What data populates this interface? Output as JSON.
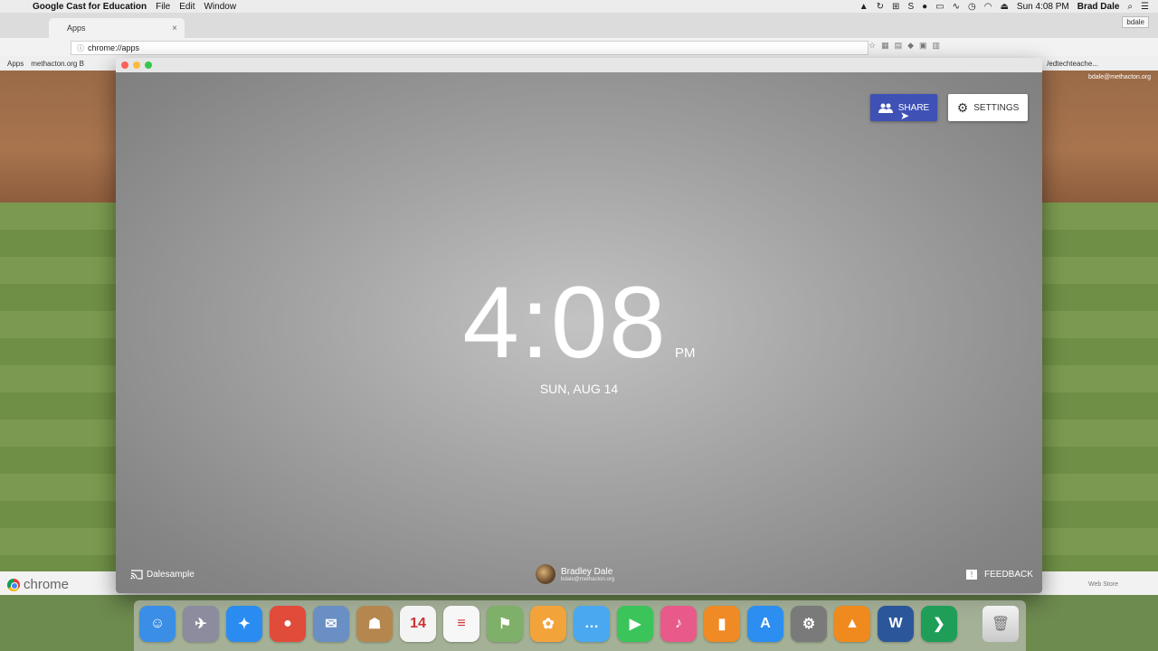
{
  "menubar": {
    "app_name": "Google Cast for Education",
    "items": [
      "File",
      "Edit",
      "Window"
    ],
    "clock": "Sun 4:08 PM",
    "user": "Brad Dale",
    "status_icons": [
      "drive-icon",
      "sync-icon",
      "grid-icon",
      "s-icon",
      "mic-icon",
      "airplay-icon",
      "wave-icon",
      "time-machine-icon",
      "wifi-icon",
      "eject-icon"
    ]
  },
  "browser": {
    "tab_title": "Apps",
    "address": "chrome://apps",
    "user_chip": "bdale",
    "bookmarks": [
      "Apps",
      "methacton.org B"
    ],
    "bookmark_right": "/edtechteache...",
    "email_corner": "bdale@methacton.org",
    "footer_logo": "chrome",
    "web_store": "Web Store"
  },
  "cast": {
    "share_label": "SHARE",
    "settings_label": "SETTINGS",
    "time": "4:08",
    "ampm": "PM",
    "date": "SUN, AUG 14",
    "device_name": "Dalesample",
    "user_name": "Bradley Dale",
    "user_email": "bdale@methacton.org",
    "feedback_label": "FEEDBACK",
    "accent_color": "#3f51b5"
  },
  "dock": {
    "apps": [
      {
        "name": "finder-icon",
        "glyph": "☺",
        "color": "#3a8ee6"
      },
      {
        "name": "launchpad-icon",
        "glyph": "✈",
        "color": "#8c8c9e"
      },
      {
        "name": "safari-icon",
        "glyph": "✦",
        "color": "#2a8cf0"
      },
      {
        "name": "chrome-icon",
        "glyph": "●",
        "color": "#e04b3a"
      },
      {
        "name": "preview-icon",
        "glyph": "✉",
        "color": "#6a8fc4"
      },
      {
        "name": "contacts-icon",
        "glyph": "☗",
        "color": "#b5874f"
      },
      {
        "name": "calendar-icon",
        "glyph": "14",
        "color": "#f4f4f4"
      },
      {
        "name": "reminders-icon",
        "glyph": "≡",
        "color": "#f7f7f7"
      },
      {
        "name": "maps-icon",
        "glyph": "⚑",
        "color": "#7fb069"
      },
      {
        "name": "photos-icon",
        "glyph": "✿",
        "color": "#f2a33a"
      },
      {
        "name": "messages-icon",
        "glyph": "…",
        "color": "#4aa8f0"
      },
      {
        "name": "facetime-icon",
        "glyph": "▶",
        "color": "#3bc45a"
      },
      {
        "name": "itunes-icon",
        "glyph": "♪",
        "color": "#e85a8a"
      },
      {
        "name": "ibooks-icon",
        "glyph": "▮",
        "color": "#f08a24"
      },
      {
        "name": "app-store-icon",
        "glyph": "A",
        "color": "#2b8ef0"
      },
      {
        "name": "system-preferences-icon",
        "glyph": "⚙",
        "color": "#7a7a7a"
      },
      {
        "name": "vlc-icon",
        "glyph": "▲",
        "color": "#f08a1e"
      },
      {
        "name": "word-icon",
        "glyph": "W",
        "color": "#2b579a"
      },
      {
        "name": "cast-icon",
        "glyph": "❯",
        "color": "#1e9e57"
      }
    ]
  }
}
